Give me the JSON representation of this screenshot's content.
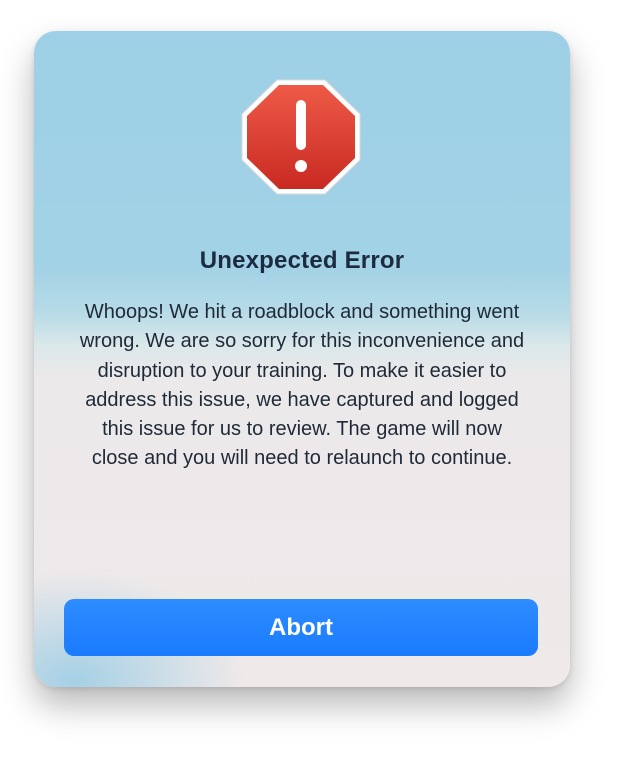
{
  "dialog": {
    "title": "Unexpected Error",
    "message": "Whoops! We hit a roadblock and something went wrong. We are so sorry for this inconvenience and disruption to your training. To make it easier to address this issue, we have captured and logged this issue for us to review. The game will now close and you will need to relaunch to continue.",
    "abort_label": "Abort",
    "icon": "stop-error-icon"
  },
  "colors": {
    "button": "#1a7bff",
    "icon_red": "#d8382c",
    "title_text": "#1d2b40"
  }
}
